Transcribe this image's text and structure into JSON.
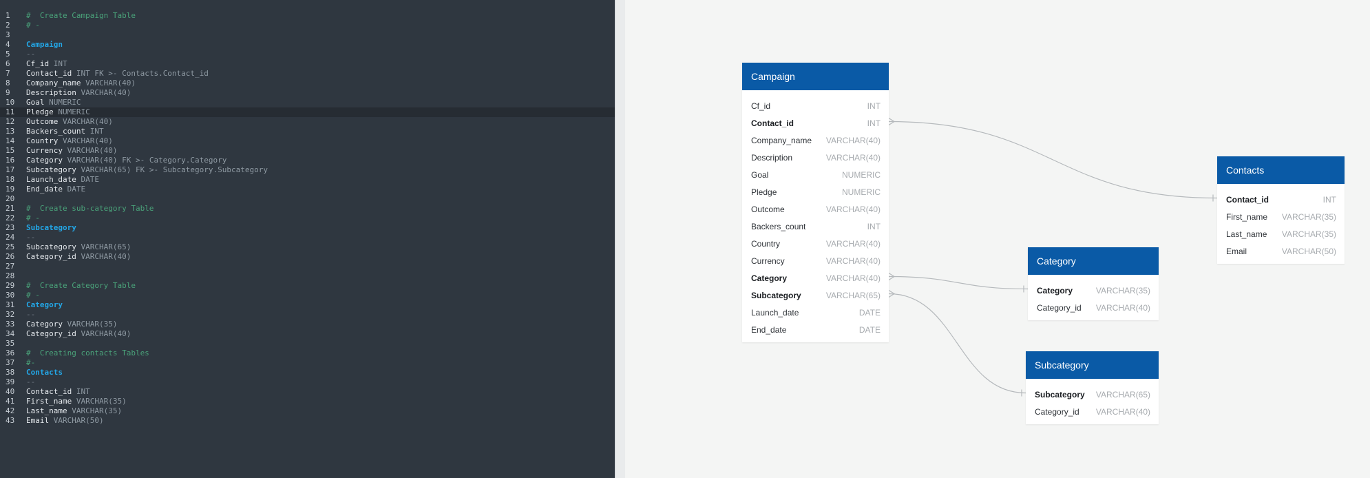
{
  "editor": {
    "highlight_line": 11,
    "lines": [
      {
        "n": "1",
        "tokens": [
          {
            "c": "comment",
            "t": "#  Create Campaign Table"
          }
        ]
      },
      {
        "n": "2",
        "tokens": [
          {
            "c": "comment",
            "t": "# -"
          }
        ]
      },
      {
        "n": "3",
        "tokens": []
      },
      {
        "n": "4",
        "tokens": [
          {
            "c": "table",
            "t": "Campaign"
          }
        ]
      },
      {
        "n": "5",
        "tokens": [
          {
            "c": "sep",
            "t": "--"
          }
        ]
      },
      {
        "n": "6",
        "tokens": [
          {
            "c": "name",
            "t": "Cf_id "
          },
          {
            "c": "type",
            "t": "INT"
          }
        ]
      },
      {
        "n": "7",
        "tokens": [
          {
            "c": "name",
            "t": "Contact_id "
          },
          {
            "c": "type",
            "t": "INT FK >- Contacts.Contact_id"
          }
        ]
      },
      {
        "n": "8",
        "tokens": [
          {
            "c": "name",
            "t": "Company_name "
          },
          {
            "c": "type",
            "t": "VARCHAR(40)"
          }
        ]
      },
      {
        "n": "9",
        "tokens": [
          {
            "c": "name",
            "t": "Description "
          },
          {
            "c": "type",
            "t": "VARCHAR(40)"
          }
        ]
      },
      {
        "n": "10",
        "tokens": [
          {
            "c": "name",
            "t": "Goal "
          },
          {
            "c": "type",
            "t": "NUMERIC"
          }
        ]
      },
      {
        "n": "11",
        "tokens": [
          {
            "c": "name",
            "t": "Pledge "
          },
          {
            "c": "type",
            "t": "NUMERIC"
          }
        ]
      },
      {
        "n": "12",
        "tokens": [
          {
            "c": "name",
            "t": "Outcome "
          },
          {
            "c": "type",
            "t": "VARCHAR(40)"
          }
        ]
      },
      {
        "n": "13",
        "tokens": [
          {
            "c": "name",
            "t": "Backers_count "
          },
          {
            "c": "type",
            "t": "INT"
          }
        ]
      },
      {
        "n": "14",
        "tokens": [
          {
            "c": "name",
            "t": "Country "
          },
          {
            "c": "type",
            "t": "VARCHAR(40)"
          }
        ]
      },
      {
        "n": "15",
        "tokens": [
          {
            "c": "name",
            "t": "Currency "
          },
          {
            "c": "type",
            "t": "VARCHAR(40)"
          }
        ]
      },
      {
        "n": "16",
        "tokens": [
          {
            "c": "name",
            "t": "Category "
          },
          {
            "c": "type",
            "t": "VARCHAR(40) FK >- Category.Category"
          }
        ]
      },
      {
        "n": "17",
        "tokens": [
          {
            "c": "name",
            "t": "Subcategory "
          },
          {
            "c": "type",
            "t": "VARCHAR(65) FK >- Subcategory.Subcategory"
          }
        ]
      },
      {
        "n": "18",
        "tokens": [
          {
            "c": "name",
            "t": "Launch_date "
          },
          {
            "c": "type",
            "t": "DATE"
          }
        ]
      },
      {
        "n": "19",
        "tokens": [
          {
            "c": "name",
            "t": "End_date "
          },
          {
            "c": "type",
            "t": "DATE"
          }
        ]
      },
      {
        "n": "20",
        "tokens": []
      },
      {
        "n": "21",
        "tokens": [
          {
            "c": "comment",
            "t": "#  Create sub-category Table"
          }
        ]
      },
      {
        "n": "22",
        "tokens": [
          {
            "c": "comment",
            "t": "# -"
          }
        ]
      },
      {
        "n": "23",
        "tokens": [
          {
            "c": "table",
            "t": "Subcategory"
          }
        ]
      },
      {
        "n": "24",
        "tokens": [
          {
            "c": "sep",
            "t": "--"
          }
        ]
      },
      {
        "n": "25",
        "tokens": [
          {
            "c": "name",
            "t": "Subcategory "
          },
          {
            "c": "type",
            "t": "VARCHAR(65)"
          }
        ]
      },
      {
        "n": "26",
        "tokens": [
          {
            "c": "name",
            "t": "Category_id "
          },
          {
            "c": "type",
            "t": "VARCHAR(40)"
          }
        ]
      },
      {
        "n": "27",
        "tokens": []
      },
      {
        "n": "28",
        "tokens": []
      },
      {
        "n": "29",
        "tokens": [
          {
            "c": "comment",
            "t": "#  Create Category Table"
          }
        ]
      },
      {
        "n": "30",
        "tokens": [
          {
            "c": "comment",
            "t": "# -"
          }
        ]
      },
      {
        "n": "31",
        "tokens": [
          {
            "c": "table",
            "t": "Category"
          }
        ]
      },
      {
        "n": "32",
        "tokens": [
          {
            "c": "sep",
            "t": "--"
          }
        ]
      },
      {
        "n": "33",
        "tokens": [
          {
            "c": "name",
            "t": "Category "
          },
          {
            "c": "type",
            "t": "VARCHAR(35)"
          }
        ]
      },
      {
        "n": "34",
        "tokens": [
          {
            "c": "name",
            "t": "Category_id "
          },
          {
            "c": "type",
            "t": "VARCHAR(40)"
          }
        ]
      },
      {
        "n": "35",
        "tokens": []
      },
      {
        "n": "36",
        "tokens": [
          {
            "c": "comment",
            "t": "#  Creating contacts Tables"
          }
        ]
      },
      {
        "n": "37",
        "tokens": [
          {
            "c": "comment",
            "t": "#-"
          }
        ]
      },
      {
        "n": "38",
        "tokens": [
          {
            "c": "table",
            "t": "Contacts"
          }
        ]
      },
      {
        "n": "39",
        "tokens": [
          {
            "c": "sep",
            "t": "--"
          }
        ]
      },
      {
        "n": "40",
        "tokens": [
          {
            "c": "name",
            "t": "Contact_id "
          },
          {
            "c": "type",
            "t": "INT"
          }
        ]
      },
      {
        "n": "41",
        "tokens": [
          {
            "c": "name",
            "t": "First_name "
          },
          {
            "c": "type",
            "t": "VARCHAR(35)"
          }
        ]
      },
      {
        "n": "42",
        "tokens": [
          {
            "c": "name",
            "t": "Last_name "
          },
          {
            "c": "type",
            "t": "VARCHAR(35)"
          }
        ]
      },
      {
        "n": "43",
        "tokens": [
          {
            "c": "name",
            "t": "Email "
          },
          {
            "c": "type",
            "t": "VARCHAR(50)"
          }
        ]
      }
    ]
  },
  "diagram": {
    "tables": [
      {
        "id": "campaign",
        "title": "Campaign",
        "columns": [
          {
            "name": "Cf_id",
            "type": "INT",
            "key": false
          },
          {
            "name": "Contact_id",
            "type": "INT",
            "key": true
          },
          {
            "name": "Company_name",
            "type": "VARCHAR(40)",
            "key": false
          },
          {
            "name": "Description",
            "type": "VARCHAR(40)",
            "key": false
          },
          {
            "name": "Goal",
            "type": "NUMERIC",
            "key": false
          },
          {
            "name": "Pledge",
            "type": "NUMERIC",
            "key": false
          },
          {
            "name": "Outcome",
            "type": "VARCHAR(40)",
            "key": false
          },
          {
            "name": "Backers_count",
            "type": "INT",
            "key": false
          },
          {
            "name": "Country",
            "type": "VARCHAR(40)",
            "key": false
          },
          {
            "name": "Currency",
            "type": "VARCHAR(40)",
            "key": false
          },
          {
            "name": "Category",
            "type": "VARCHAR(40)",
            "key": true
          },
          {
            "name": "Subcategory",
            "type": "VARCHAR(65)",
            "key": true
          },
          {
            "name": "Launch_date",
            "type": "DATE",
            "key": false
          },
          {
            "name": "End_date",
            "type": "DATE",
            "key": false
          }
        ]
      },
      {
        "id": "contacts",
        "title": "Contacts",
        "columns": [
          {
            "name": "Contact_id",
            "type": "INT",
            "key": true
          },
          {
            "name": "First_name",
            "type": "VARCHAR(35)",
            "key": false
          },
          {
            "name": "Last_name",
            "type": "VARCHAR(35)",
            "key": false
          },
          {
            "name": "Email",
            "type": "VARCHAR(50)",
            "key": false
          }
        ]
      },
      {
        "id": "category",
        "title": "Category",
        "columns": [
          {
            "name": "Category",
            "type": "VARCHAR(35)",
            "key": true
          },
          {
            "name": "Category_id",
            "type": "VARCHAR(40)",
            "key": false
          }
        ]
      },
      {
        "id": "subcategory",
        "title": "Subcategory",
        "columns": [
          {
            "name": "Subcategory",
            "type": "VARCHAR(65)",
            "key": true
          },
          {
            "name": "Category_id",
            "type": "VARCHAR(40)",
            "key": false
          }
        ]
      }
    ],
    "relationships": [
      {
        "from_table": "campaign",
        "from_column": "Contact_id",
        "to_table": "contacts",
        "to_column": "Contact_id"
      },
      {
        "from_table": "campaign",
        "from_column": "Category",
        "to_table": "category",
        "to_column": "Category"
      },
      {
        "from_table": "campaign",
        "from_column": "Subcategory",
        "to_table": "subcategory",
        "to_column": "Subcategory"
      }
    ],
    "colors": {
      "header": "#0a5aa6",
      "connector": "#b5b9bc",
      "editor_bg": "#2f3740"
    }
  }
}
